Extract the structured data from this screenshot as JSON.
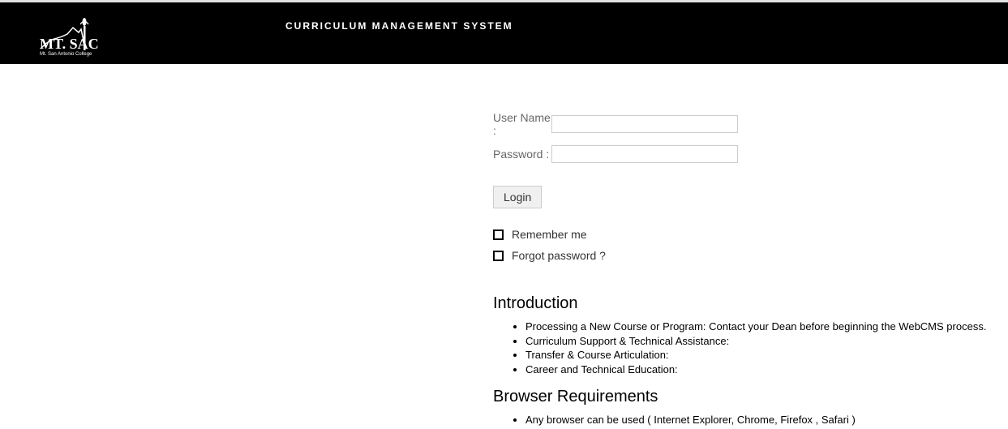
{
  "header": {
    "title": "CURRICULUM MANAGEMENT SYSTEM",
    "logo_text_main": "MT. SAC",
    "logo_text_sub": "Mt. San Antonio College"
  },
  "login": {
    "username_label": "User Name :",
    "username_value": "",
    "password_label": "Password :",
    "password_value": "",
    "login_button": "Login",
    "remember_me": "Remember me",
    "forgot_password": "Forgot password ?"
  },
  "introduction": {
    "title": "Introduction",
    "items": [
      "Processing a New Course or Program: Contact your Dean before beginning the WebCMS process.",
      "Curriculum Support & Technical Assistance:",
      "Transfer & Course Articulation:",
      "Career and Technical Education:"
    ]
  },
  "browser_requirements": {
    "title": "Browser Requirements",
    "items": [
      "Any browser can be used ( Internet Explorer, Chrome, Firefox , Safari )"
    ]
  }
}
